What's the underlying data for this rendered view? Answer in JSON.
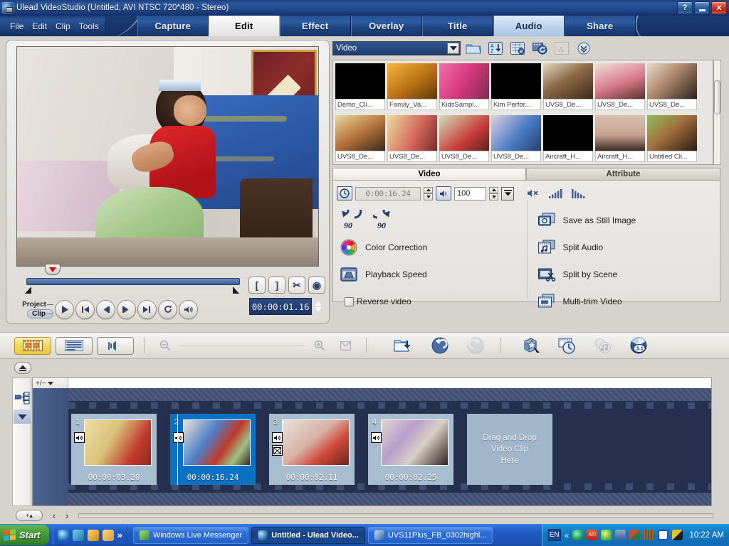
{
  "window": {
    "title": "Ulead VideoStudio (Untitled, AVI NTSC 720*480 - Stereo)",
    "help_label": "?",
    "minimize_label": "",
    "close_label": "✕"
  },
  "menubar": {
    "items": [
      "File",
      "Edit",
      "Clip",
      "Tools"
    ]
  },
  "steps": [
    {
      "label": "Capture",
      "state": "normal"
    },
    {
      "label": "Edit",
      "state": "active"
    },
    {
      "label": "Effect",
      "state": "normal"
    },
    {
      "label": "Overlay",
      "state": "normal"
    },
    {
      "label": "Title",
      "state": "normal"
    },
    {
      "label": "Audio",
      "state": "hover"
    },
    {
      "label": "Share",
      "state": "normal"
    }
  ],
  "preview": {
    "mode_project": "Project",
    "mode_clip": "Clip",
    "timecode": "00:00:01.16",
    "transport": [
      {
        "name": "play-button",
        "glyph": "play"
      },
      {
        "name": "home-button",
        "glyph": "home"
      },
      {
        "name": "previous-frame-button",
        "glyph": "prev"
      },
      {
        "name": "next-frame-button",
        "glyph": "next"
      },
      {
        "name": "end-button",
        "glyph": "end"
      },
      {
        "name": "repeat-button",
        "glyph": "repeat"
      },
      {
        "name": "system-volume-button",
        "glyph": "volume"
      }
    ],
    "mark_buttons": [
      {
        "name": "mark-in-button",
        "label": "["
      },
      {
        "name": "mark-out-button",
        "label": "]"
      },
      {
        "name": "cut-clip-button",
        "label": "✂"
      },
      {
        "name": "enlarge-preview-button",
        "label": "◉"
      }
    ]
  },
  "library": {
    "category_value": "Video",
    "toolbar_icons": [
      {
        "name": "load-video-icon",
        "title": "Load video"
      },
      {
        "name": "sort-alphabetically-icon",
        "title": "Sort by name"
      },
      {
        "name": "library-options-icon",
        "title": "Library options"
      },
      {
        "name": "convert-media-icon",
        "title": "Convert"
      },
      {
        "name": "add-text-icon",
        "title": "Add",
        "disabled": true
      },
      {
        "name": "expand-library-icon",
        "title": "Expand"
      }
    ],
    "items": [
      {
        "caption": "Demo_Cli...",
        "thumb": "black"
      },
      {
        "caption": "Family_Va...",
        "thumb": "amber"
      },
      {
        "caption": "KidsSampl...",
        "thumb": "pink"
      },
      {
        "caption": "Kim Perfor...",
        "thumb": "black"
      },
      {
        "caption": "UVS8_De...",
        "thumb": "table"
      },
      {
        "caption": "UVS8_De...",
        "thumb": "cake"
      },
      {
        "caption": "UVS8_De...",
        "thumb": "party"
      },
      {
        "caption": "UVS8_De...",
        "thumb": "kids"
      },
      {
        "caption": "UVS8_De...",
        "thumb": "girl"
      },
      {
        "caption": "UVS8_De...",
        "thumb": "gift"
      },
      {
        "caption": "UVS8_De...",
        "thumb": "bed"
      },
      {
        "caption": "Aircraft_H...",
        "thumb": "black"
      },
      {
        "caption": "Aircraft_H...",
        "thumb": "sky"
      },
      {
        "caption": "Untitled Cli...",
        "thumb": "man"
      }
    ]
  },
  "options": {
    "tabs": [
      {
        "label": "Video",
        "active": true
      },
      {
        "label": "Attribute",
        "active": false
      }
    ],
    "duration_value": "0:00:16.24",
    "volume_value": "100",
    "left_column": [
      {
        "name": "rotate-left-90-button",
        "label": "90"
      },
      {
        "name": "rotate-right-90-button",
        "label": "90"
      },
      {
        "name": "color-correction-button",
        "label": "Color Correction"
      },
      {
        "name": "playback-speed-button",
        "label": "Playback Speed"
      },
      {
        "name": "reverse-video-checkbox",
        "label": "Reverse video"
      }
    ],
    "right_column": [
      {
        "name": "save-as-still-image-button",
        "label": "Save as Still Image"
      },
      {
        "name": "split-audio-button",
        "label": "Split Audio"
      },
      {
        "name": "split-by-scene-button",
        "label": "Split by Scene"
      },
      {
        "name": "multi-trim-video-button",
        "label": "Multi-trim Video"
      }
    ],
    "audio_icons": [
      {
        "name": "mute-icon"
      },
      {
        "name": "fade-in-icon"
      },
      {
        "name": "fade-out-icon"
      }
    ]
  },
  "toolbar": {
    "views": [
      {
        "name": "storyboard-view-button",
        "active": true
      },
      {
        "name": "timeline-view-button",
        "active": false
      },
      {
        "name": "audio-view-button",
        "active": false
      }
    ],
    "tools": [
      {
        "name": "insert-media-files-icon",
        "disabled": false
      },
      {
        "name": "undo-icon",
        "disabled": false
      },
      {
        "name": "redo-icon",
        "disabled": true
      },
      {
        "name": "smart-proxy-manager-icon",
        "disabled": false
      },
      {
        "name": "batch-convert-icon",
        "disabled": false
      },
      {
        "name": "auto-music-icon",
        "disabled": true
      },
      {
        "name": "surround-sound-5-1-icon",
        "label": "5.1",
        "disabled": false
      }
    ],
    "zoom_out_name": "zoom-out-icon",
    "zoom_in_name": "zoom-in-icon",
    "fit_name": "fit-project-in-window-icon"
  },
  "timeline": {
    "track_header_label": "+/−",
    "add_button_label": "+▴",
    "prev_label": "‹",
    "next_label": "›",
    "clips": [
      {
        "number": "1",
        "duration": "00:00:03.20",
        "selected": false,
        "has_audio": true,
        "has_effect": false,
        "thumb": "girl-eating"
      },
      {
        "number": "2",
        "duration": "00:00:16.24",
        "selected": true,
        "has_audio": true,
        "has_effect": false,
        "thumb": "bed-scene"
      },
      {
        "number": "3",
        "duration": "00:00:02.11",
        "selected": false,
        "has_audio": true,
        "has_effect": true,
        "thumb": "cake"
      },
      {
        "number": "4",
        "duration": "00:00:02.25",
        "selected": false,
        "has_audio": true,
        "has_effect": false,
        "thumb": "party-table"
      }
    ],
    "dropzone_text": "Drag and Drop\nVideo Clip\nHere",
    "dropzone_line1": "Drag and Drop",
    "dropzone_line2": "Video Clip",
    "dropzone_line3": "Here"
  },
  "taskbar": {
    "start_label": "Start",
    "quick_launch": [
      {
        "name": "internet-explorer-icon"
      },
      {
        "name": "outlook-express-icon"
      },
      {
        "name": "media-player-icon"
      },
      {
        "name": "show-desktop-folder-icon"
      }
    ],
    "quick_more_label": "»",
    "tasks": [
      {
        "label": "Windows Live Messenger",
        "active": false,
        "icon": "messenger-icon"
      },
      {
        "label": "Untitled - Ulead Video...",
        "active": true,
        "icon": "ulead-icon"
      },
      {
        "label": "UVS11Plus_FB_0302highl...",
        "active": false,
        "icon": "word-icon"
      }
    ],
    "language": "EN",
    "tray_chevron": "«",
    "tray_icons": [
      {
        "name": "antivirus-icon",
        "color": "#1fa463"
      },
      {
        "name": "ati-catalyst-icon",
        "color": "#e02b18"
      },
      {
        "name": "safety-icon",
        "color": "#7dd44a"
      },
      {
        "name": "network-disconnected-icon",
        "color": "#4b6fa8"
      },
      {
        "name": "messenger-tray-icon",
        "color": "#2f7f3f"
      },
      {
        "name": "equalizer-icon",
        "color": "#d13b2a"
      },
      {
        "name": "mail-icon",
        "color": "#1f4fc4"
      },
      {
        "name": "display-icon",
        "color": "#d9b30e"
      }
    ],
    "clock": "10:22 AM"
  }
}
